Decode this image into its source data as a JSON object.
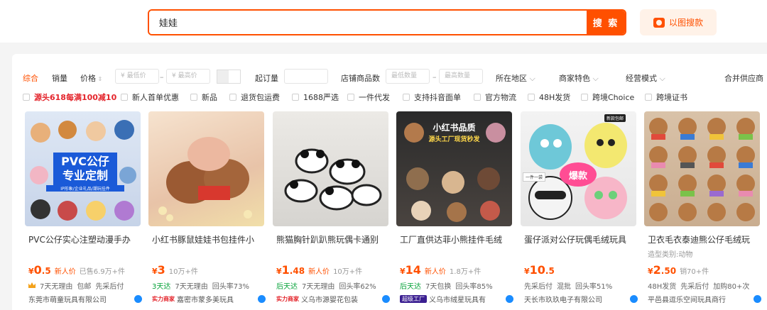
{
  "search": {
    "query": "娃娃",
    "button": "搜 索",
    "image_search": "以图搜款"
  },
  "filter": {
    "sort_default": "综合",
    "sort_sales": "销量",
    "sort_price": "价格",
    "price_min_ph": "¥ 最低价",
    "price_max_ph": "¥ 最高价",
    "price_dash": "–",
    "moq": "起订量",
    "store_count": "店铺商品数",
    "count_min_ph": "最低数量",
    "count_max_ph": "最高数量",
    "count_dash": "–",
    "region": "所在地区",
    "features": "商家特色",
    "model": "经营模式",
    "merge": "合并供应商"
  },
  "checkboxes": [
    "源头618每满100减10",
    "新人首单优惠",
    "新品",
    "退货包运费",
    "1688严选",
    "一件代发",
    "支持抖音面单",
    "官方物流",
    "48H发货",
    "跨境Choice",
    "跨境证书"
  ],
  "products": [
    {
      "title": "PVC公仔实心注塑动漫手办",
      "subtitle": "",
      "price_int": "0",
      "price_dec": ".5",
      "new_tag": "新人价",
      "sold": "已售6.9万+件",
      "services": [
        "7天无理由",
        "包邮",
        "先采后付"
      ],
      "shop": "东莞市萌童玩具有限公司",
      "shop_badge": "",
      "img": {
        "banner": "PVC公仔",
        "banner2": "专业定制",
        "sub": "IP形象/企业礼品/潮玩挂件"
      }
    },
    {
      "title": "小红书豚鼠娃娃书包挂件小",
      "subtitle": "",
      "price_int": "3",
      "price_dec": "",
      "new_tag": "",
      "sold": "10万+件",
      "services_green": "3天达",
      "services": [
        "7天无理由",
        "回头率73%"
      ],
      "shop": "嘉密市蒙多美玩具",
      "shop_badge": "实力商家"
    },
    {
      "title": "熊猫胸针趴趴熊玩偶卡通别",
      "subtitle": "",
      "price_int": "1",
      "price_dec": ".48",
      "new_tag": "新人价",
      "sold": "10万+件",
      "services_green": "后天达",
      "services": [
        "7天无理由",
        "回头率62%"
      ],
      "shop": "义乌市源婴花包装",
      "shop_badge": "实力商家"
    },
    {
      "title": "工厂直供达菲小熊挂件毛绒",
      "subtitle": "",
      "price_int": "14",
      "price_dec": "",
      "new_tag": "新人价",
      "sold": "1.8万+件",
      "services_green": "后天达",
      "services": [
        "7天包换",
        "回头率85%"
      ],
      "shop": "义乌市绒星玩具有",
      "shop_badge": "超级工厂",
      "img": {
        "banner": "小红书品质",
        "banner2": "源头工厂现货秒发"
      }
    },
    {
      "title": "蛋仔派对公仔玩偶毛绒玩具",
      "subtitle": "",
      "price_int": "10",
      "price_dec": ".5",
      "new_tag": "",
      "sold": "",
      "services": [
        "先采后付",
        "混批",
        "回头率51%"
      ],
      "shop": "天长市玖玖电子有限公司",
      "shop_badge": "",
      "img": {
        "hot": "爆款",
        "tag1": "新款包邮",
        "tag2": "一件一袋"
      }
    },
    {
      "title": "卫衣毛衣泰迪熊公仔毛绒玩",
      "subtitle": "造型类别:动物",
      "price_int": "2",
      "price_dec": ".50",
      "new_tag": "",
      "sold": "销70+件",
      "services": [
        "48H发货",
        "先采后付",
        "加购80+次"
      ],
      "shop": "平邑县逗乐空间玩具商行",
      "shop_badge": ""
    }
  ],
  "colors": {
    "accent": "#ff5000",
    "green": "#07a33a",
    "link": "#1a8cff"
  }
}
